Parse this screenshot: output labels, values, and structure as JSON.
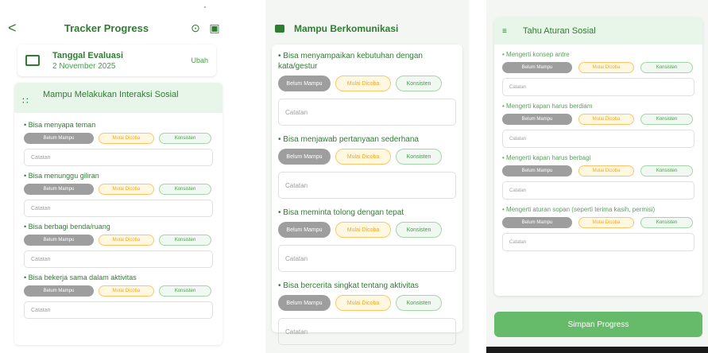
{
  "panel1": {
    "header": {
      "back_icon": "arrow-left-icon",
      "title": "Tracker Progress",
      "history_icon": "history-icon",
      "save_icon": "save-icon"
    },
    "date_card": {
      "label": "Tanggal Evaluasi",
      "value": "2 November 2025",
      "edit": "Ubah"
    },
    "section": {
      "title": "Mampu Melakukan Interaksi Sosial",
      "icon": "people-icon",
      "items": [
        {
          "text": "• Bisa menyapa teman"
        },
        {
          "text": "• Bisa menunggu giliran"
        },
        {
          "text": "• Bisa berbagi benda/ruang"
        },
        {
          "text": "• Bisa bekerja sama dalam aktivitas"
        }
      ]
    }
  },
  "panel2": {
    "section": {
      "title": "Mampu Berkomunikasi",
      "icon": "chat-icon",
      "items": [
        {
          "text": "• Bisa menyampaikan kebutuhan dengan kata/gestur"
        },
        {
          "text": "• Bisa menjawab pertanyaan sederhana"
        },
        {
          "text": "• Bisa meminta tolong dengan tepat"
        },
        {
          "text": "• Bisa bercerita singkat tentang aktivitas"
        }
      ]
    }
  },
  "panel3": {
    "section": {
      "title": "Tahu Aturan Sosial",
      "icon": "rules-icon",
      "items": [
        {
          "text": "• Mengerti konsep antre"
        },
        {
          "text": "• Mengerti kapan harus berdiam"
        },
        {
          "text": "• Mengerti kapan harus berbagi"
        },
        {
          "text": "• Mengerti aturan sopan (seperti terima kasih, permisi)"
        }
      ]
    },
    "save_button": "Simpan Progress"
  },
  "options": {
    "belum": "Belum Mampu",
    "mulai": "Mulai Dicoba",
    "konsisten": "Konsisten"
  },
  "note_placeholder": "Catatan",
  "colors": {
    "primary": "#2e7d32",
    "accent": "#66bb6a",
    "header_bg": "#e8f5e9",
    "belum": "#9e9e9e",
    "mulai": "#ffc46b",
    "konsisten": "#a5d6a7"
  }
}
